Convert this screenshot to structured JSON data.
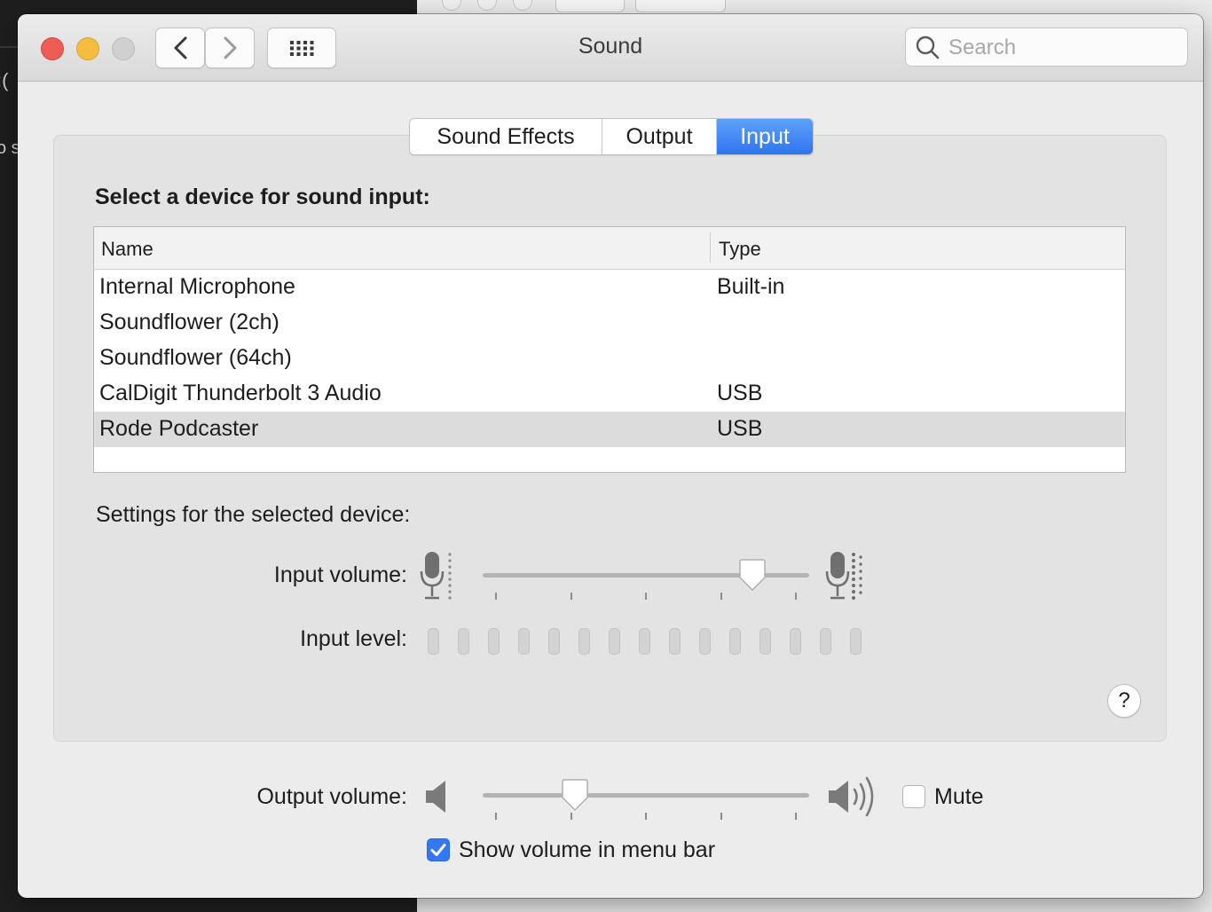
{
  "window": {
    "title": "Sound"
  },
  "toolbar": {
    "back_icon": "chevron-left-icon",
    "forward_icon": "chevron-right-icon",
    "grid_icon": "show-all-grid-icon"
  },
  "search": {
    "placeholder": "Search",
    "value": ""
  },
  "tabs": [
    {
      "label": "Sound Effects",
      "active": false
    },
    {
      "label": "Output",
      "active": false
    },
    {
      "label": "Input",
      "active": true
    }
  ],
  "input": {
    "heading": "Select a device for sound input:",
    "columns": [
      "Name",
      "Type"
    ],
    "devices": [
      {
        "name": "Internal Microphone",
        "type": "Built-in"
      },
      {
        "name": "Soundflower (2ch)",
        "type": ""
      },
      {
        "name": "Soundflower (64ch)",
        "type": ""
      },
      {
        "name": "CalDigit Thunderbolt 3 Audio",
        "type": "USB"
      },
      {
        "name": "Rode Podcaster",
        "type": "USB",
        "selected": true
      }
    ],
    "settings_label": "Settings for the selected device:",
    "volume_label": "Input volume:",
    "volume_fraction": 0.86,
    "level_label": "Input level:",
    "level_segments": 15,
    "level_lit": 0
  },
  "help": {
    "label": "?"
  },
  "output": {
    "volume_label": "Output volume:",
    "volume_fraction": 0.26,
    "mute_label": "Mute",
    "mute_checked": false,
    "show_in_menubar_label": "Show volume in menu bar",
    "show_in_menubar_checked": true
  },
  "colors": {
    "accent": "#3478f6",
    "close": "#ee5c55",
    "minimize": "#f5bd3f",
    "zoom_disabled": "#cccccc"
  }
}
